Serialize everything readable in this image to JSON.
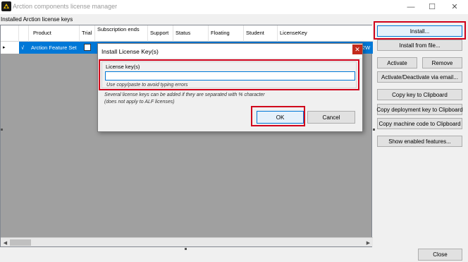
{
  "window": {
    "title": "Arction components license manager",
    "minimize_glyph": "—",
    "maximize_glyph": "☐",
    "close_glyph": "✕"
  },
  "section_label": "Installed Arction license keys",
  "grid": {
    "columns": [
      "Product",
      "Trial",
      "Subscription ends",
      "Support",
      "Status",
      "Floating",
      "Student",
      "LicenseKey"
    ],
    "rows": [
      {
        "indicator": "▸",
        "flag": "√",
        "product": "Arction Feature Set",
        "trial_checked": false,
        "subscription_fragment": "2",
        "licensekey_fragment": "2W"
      }
    ]
  },
  "buttons": {
    "install": "Install...",
    "install_from_file": "Install from file...",
    "activate": "Activate",
    "remove": "Remove",
    "activate_via_email": "Activate/Deactivate via email...",
    "copy_key": "Copy key to Clipboard",
    "copy_deployment_key": "Copy deployment key to Clipboard",
    "copy_machine_code": "Copy machine code to Clipboard",
    "show_features": "Show enabled features...",
    "close": "Close"
  },
  "dialog": {
    "title": "Install License Key(s)",
    "close_glyph": "✕",
    "group_label": "License key(s)",
    "input_value": "",
    "hint": "Use copy/paste to avoid typing errors",
    "note_line1": "Several license keys can be added if they are separated with % character",
    "note_line2": "(does not apply to ALF licenses)",
    "ok": "OK",
    "cancel": "Cancel"
  },
  "colors": {
    "selection": "#0078d7",
    "highlight_box": "#d0021b",
    "dialog_close": "#c42b1c"
  }
}
